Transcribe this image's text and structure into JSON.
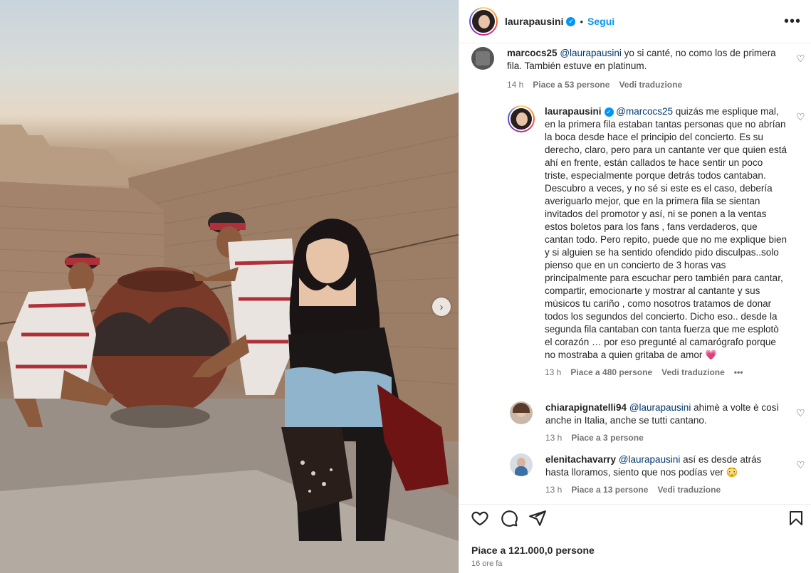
{
  "post": {
    "username": "laurapausini",
    "follow_label": "Segui",
    "more_label": "•••"
  },
  "comments": [
    {
      "username": "marcocs25",
      "mention": "@laurapausini",
      "text": " yo si canté, no como los de primera fila. También estuve en platinum.",
      "time": "14 h",
      "likes": "Piace a 53 persone",
      "translate": "Vedi traduzione"
    },
    {
      "username": "laurapausini",
      "mention": "@marcocs25",
      "text": " quizás me esplique mal, en la primera fila estaban tantas personas que no abrían la boca desde hace el principio del concierto. Es su derecho, claro, pero para un cantante ver que quien está ahí en frente, están callados te hace sentir un poco triste, especialmente porque detrás todos cantaban. Descubro a veces, y no sé si este es el caso, debería averiguarlo mejor, que en la primera fila se sientan invitados del promotor y así, ni se ponen a la ventas estos boletos para los fans , fans verdaderos, que cantan todo. Pero repito, puede que no me explique bien y si alguien se ha sentido ofendido pido disculpas..solo pienso que en un concierto de 3 horas vas principalmente para escuchar pero también para cantar, compartir, emocionarte y mostrar al cantante y sus músicos tu cariño , como nosotros tratamos de donar todos los segundos del concierto. Dicho eso.. desde la segunda fila cantaban con tanta fuerza que me esplotò el corazón … por eso pregunté al camarógrafo porque no mostraba a quien gritaba de amor",
      "emoji": "💗",
      "time": "13 h",
      "likes": "Piace a 480 persone",
      "translate": "Vedi traduzione",
      "more": "•••"
    },
    {
      "username": "chiarapignatelli94",
      "mention": "@laurapausini",
      "text": " ahimè a volte è così anche in Italia, anche se tutti cantano.",
      "time": "13 h",
      "likes": "Piace a 3 persone"
    },
    {
      "username": "elenitachavarry",
      "mention": "@laurapausini",
      "text": " así es desde atrás hasta lloramos, siento que nos podías ver",
      "emoji": "😳",
      "time": "13 h",
      "likes": "Piace a 13 persone",
      "translate": "Vedi traduzione"
    }
  ],
  "footer": {
    "likes": "Piace a 121.000,0 persone",
    "time": "16 ore fa"
  },
  "icons": {
    "heart": "heart-icon",
    "comment": "comment-icon",
    "share": "share-icon",
    "save": "bookmark-icon",
    "next": "chevron-right-icon"
  },
  "colors": {
    "accent": "#0095f6",
    "mention": "#00376b",
    "muted": "#737373",
    "emoji_heart": "#e73a6e"
  }
}
